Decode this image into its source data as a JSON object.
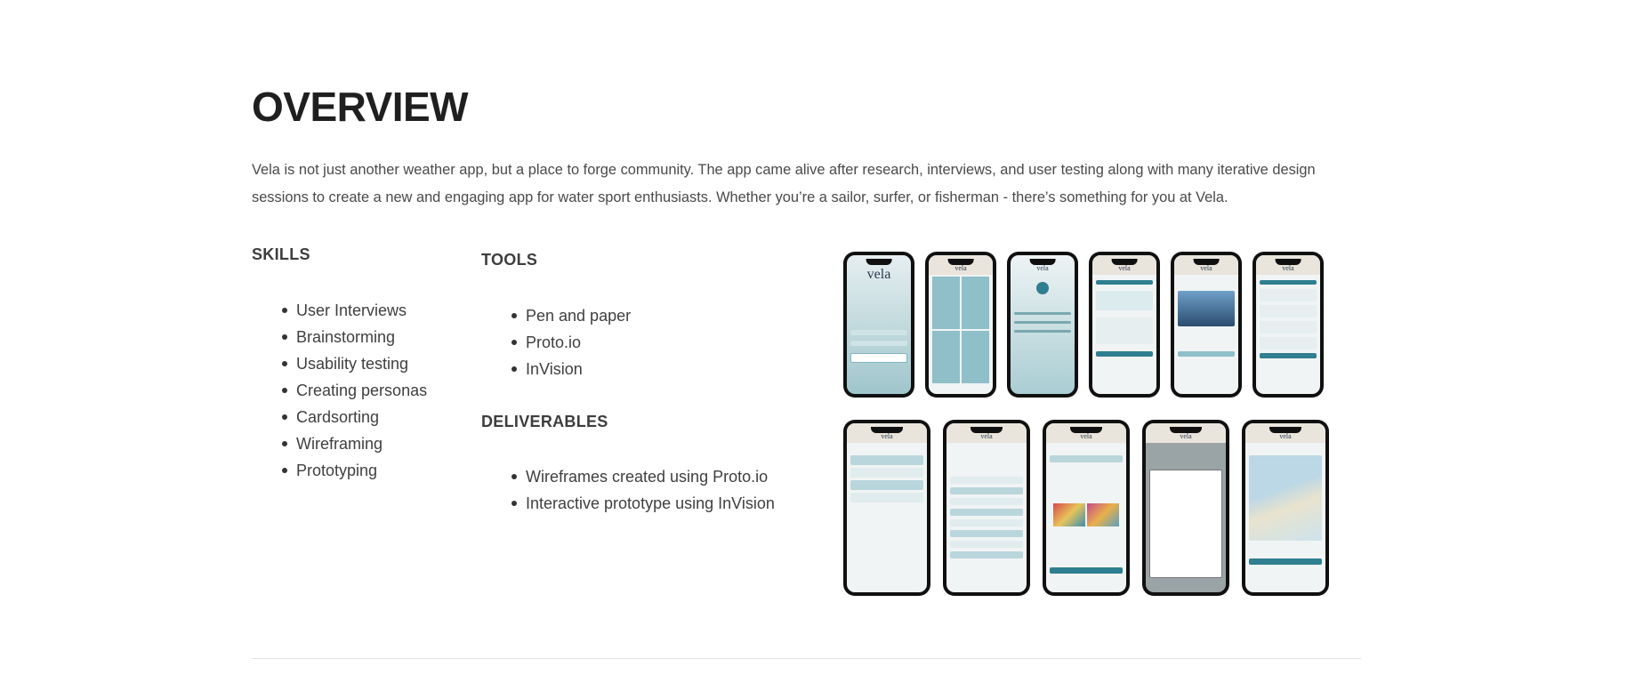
{
  "overview": {
    "title": "OVERVIEW",
    "intro": "Vela is not just another weather app, but a place to forge community. The app came alive after research, interviews, and user testing along with many iterative design sessions to create a new and engaging app for water sport enthusiasts. Whether you’re a sailor, surfer, or fisherman - there’s something for you at Vela."
  },
  "skills": {
    "heading": "SKILLS",
    "items": [
      "User Interviews",
      "Brainstorming",
      "Usability testing",
      "Creating personas",
      "Cardsorting",
      "Wireframing",
      "Prototyping"
    ]
  },
  "tools": {
    "heading": "TOOLS",
    "items": [
      "Pen and paper",
      "Proto.io",
      "InVision"
    ]
  },
  "deliverables": {
    "heading": "DELIVERABLES",
    "items": [
      "Wireframes created using Proto.io",
      "Interactive prototype using InVision"
    ]
  },
  "mockups": {
    "brand": "vela",
    "colors": {
      "teal": "#2f7f90",
      "teal_light": "#8fbfc8",
      "sky": "#b9d6dc",
      "sand": "#e9e4dc"
    }
  }
}
